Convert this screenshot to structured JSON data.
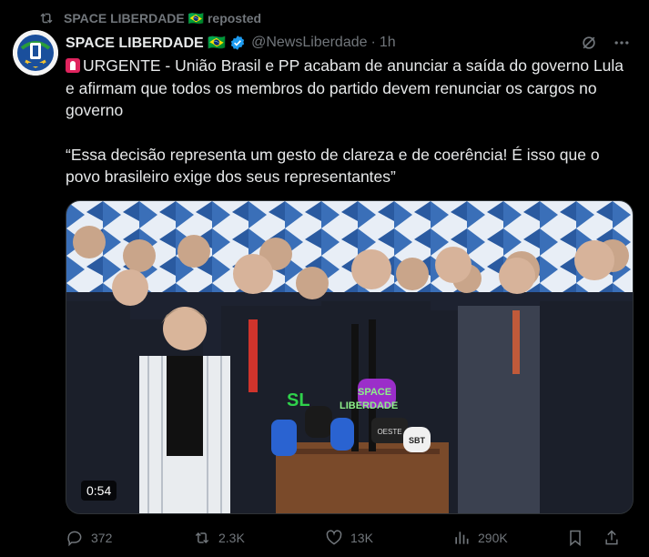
{
  "repost_line": {
    "label": "SPACE LIBERDADE 🇧🇷 reposted"
  },
  "author": {
    "name": "SPACE LIBERDADE 🇧🇷",
    "handle": "@NewsLiberdade",
    "separator": "·",
    "time": "1h"
  },
  "tweet": {
    "paragraph1": "URGENTE - União Brasil e PP acabam de anunciar a saída do governo Lula e afirmam que todos os membros do partido devem renunciar os cargos no governo",
    "paragraph2": "“Essa decisão representa um gesto de clareza e de coerência! É isso que o povo brasileiro exige dos seus representantes”"
  },
  "media": {
    "duration": "0:54",
    "watermark_line1": "SPACE",
    "watermark_line2": "LIBERDADE",
    "watermark_initials": "SL",
    "mic_labels": [
      "SBT",
      "OESTE"
    ]
  },
  "actions": {
    "replies": "372",
    "reposts": "2.3K",
    "likes": "13K",
    "views": "290K"
  },
  "icons": {
    "repost": "repost-icon",
    "verified": "verified-badge-icon",
    "grok": "grok-icon",
    "more": "more-icon",
    "reply": "reply-icon",
    "like": "heart-icon",
    "views": "views-icon",
    "bookmark": "bookmark-icon",
    "share": "share-icon"
  },
  "colors": {
    "background": "#000000",
    "text": "#e7e9ea",
    "muted": "#71767b",
    "verified": "#1d9bf0"
  }
}
